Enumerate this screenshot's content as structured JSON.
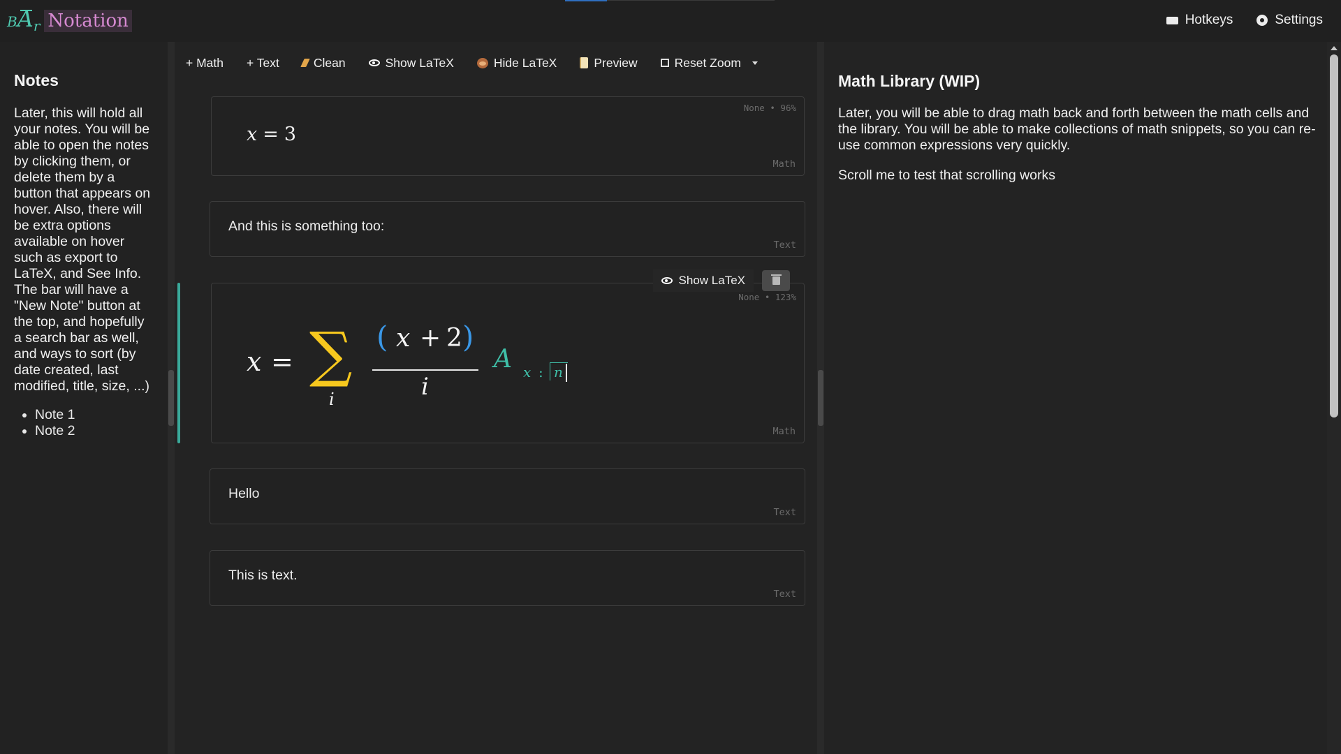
{
  "app": {
    "logo_sub_b": "B",
    "logo_main": "A",
    "logo_sub_r": "r",
    "logo_text": "Notation"
  },
  "header": {
    "hotkeys": "Hotkeys",
    "settings": "Settings"
  },
  "notes_panel": {
    "title": "Notes",
    "description": "Later, this will hold all your notes. You will be able to open the notes by clicking them, or delete them by a button that appears on hover. Also, there will be extra options available on hover such as export to LaTeX, and See Info. The bar will have a \"New Note\" button at the top, and hopefully a search bar as well, and ways to sort (by date created, last modified, title, size, ...)",
    "notes": [
      "Note 1",
      "Note 2"
    ]
  },
  "toolbar": {
    "add_math": "+ Math",
    "add_text": "+ Text",
    "clean": "Clean",
    "show_latex": "Show LaTeX",
    "hide_latex": "Hide LaTeX",
    "preview": "Preview",
    "reset_zoom": "Reset Zoom"
  },
  "cells": [
    {
      "kind": "Math",
      "meta": "None • 96%",
      "math": {
        "lhs": "x",
        "eq": "=",
        "rhs": "3"
      }
    },
    {
      "kind": "Text",
      "text": "And this is something too:"
    },
    {
      "kind": "Math",
      "meta": "None • 123%",
      "overlay_show_latex": "Show LaTeX",
      "math": {
        "lhs": "x",
        "eq": "=",
        "sum": "∑",
        "sum_index": "i",
        "lparen": "(",
        "num_x": "x",
        "plus": "+",
        "two": "2",
        "rparen": ")",
        "den": "i",
        "A": "A",
        "sub_x": "x",
        "colon": ":",
        "n": "n"
      }
    },
    {
      "kind": "Text",
      "text": "Hello"
    },
    {
      "kind": "Text",
      "text": "This is text."
    }
  ],
  "library": {
    "title": "Math Library (WIP)",
    "description": "Later, you will be able to drag math back and forth between the math cells and the library. You will be able to make collections of math snippets, so you can re-use common expressions very quickly.",
    "scroll_note": "Scroll me to test that scrolling works"
  },
  "colors": {
    "background": "#222222",
    "accent_teal": "#3fbfa8",
    "sum_yellow": "#f7c81e",
    "paren_blue": "#3a97e6",
    "logo_pink": "#d78ad2"
  },
  "icons": [
    "keyboard-icon",
    "gear-icon",
    "broom-icon",
    "eye-icon",
    "monkey-icon",
    "scroll-icon",
    "fullscreen-icon",
    "chevron-down-icon",
    "trash-icon"
  ]
}
